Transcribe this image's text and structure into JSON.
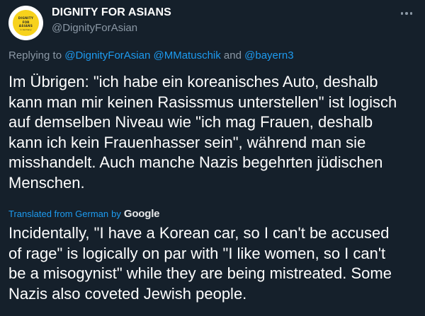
{
  "author": {
    "display_name": "DIGNITY FOR ASIANS",
    "handle": "@DignityForAsian",
    "avatar_lines": [
      "DIGNITY",
      "FOR",
      "ASIANS",
      "in Germany"
    ]
  },
  "more_icon": "more-horizontal-icon",
  "reply_context": {
    "prefix": "Replying to",
    "mention_1": "@DignityForAsian",
    "mention_2": "@MMatuschik",
    "conjunction": "and",
    "mention_3": "@bayern3"
  },
  "original_text_lines": [
    "Im Übrigen: \"ich habe ein koreanisches Auto, deshalb",
    "kann man mir keinen Rasissmus unterstellen\" ist logisch",
    "auf demselben Niveau wie \"ich mag Frauen, deshalb",
    "kann ich kein Frauenhasser sein\", während man sie",
    "misshandelt. Auch manche Nazis begehrten jüdischen",
    "Menschen."
  ],
  "translation": {
    "label": "Translated from German",
    "by": "by",
    "provider": "Google",
    "text_lines": [
      "Incidentally, \"I have a Korean car, so I can't be accused",
      "of rage\" is logically on par with \"I like women, so I can't",
      "be a misogynist\" while they are being mistreated. Some",
      "Nazis also coveted Jewish people."
    ]
  },
  "colors": {
    "background": "#15202b",
    "text": "#ffffff",
    "secondary_text": "#8b98a5",
    "link": "#1d9bf0",
    "avatar_yellow": "#f7d21c"
  }
}
